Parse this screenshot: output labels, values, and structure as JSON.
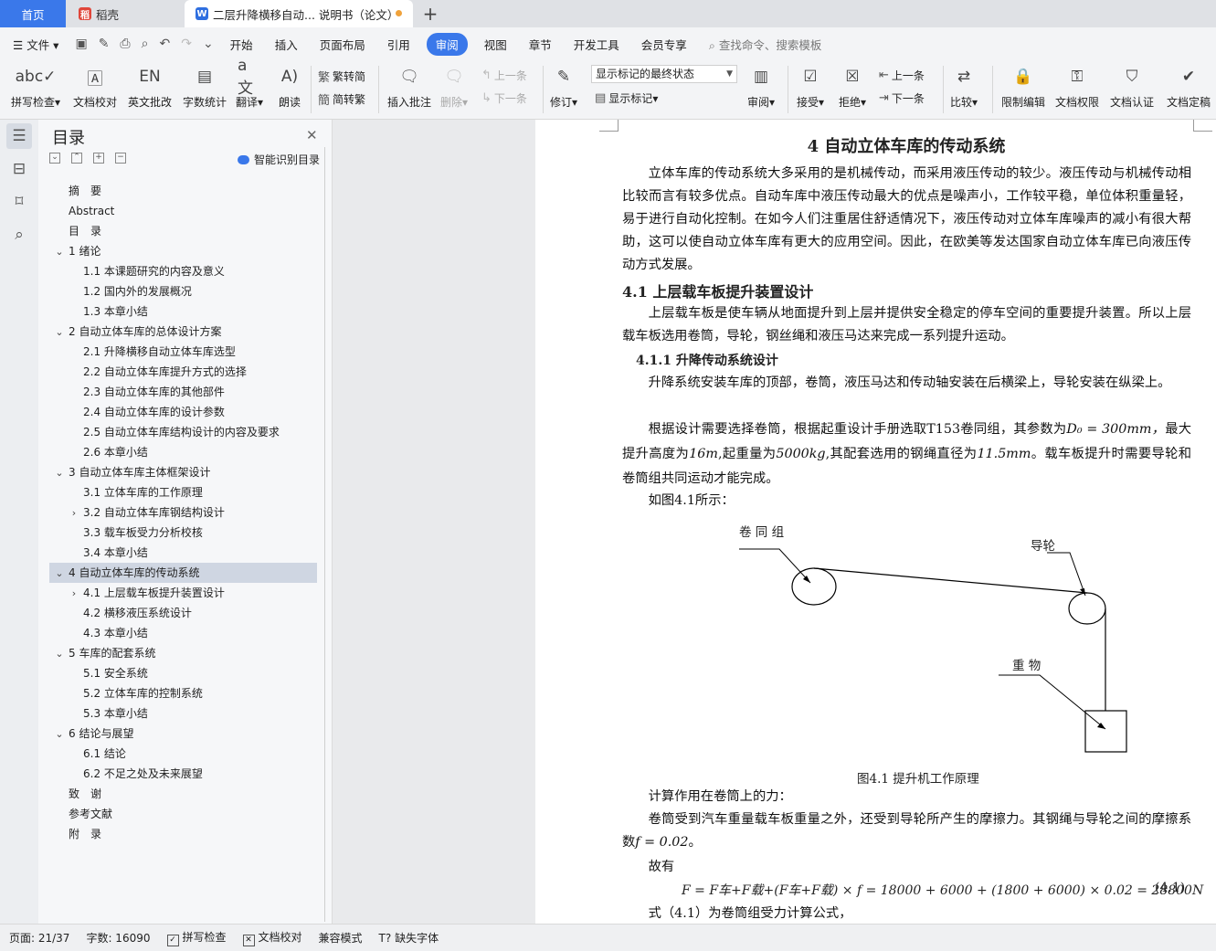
{
  "tabs": {
    "home": "首页",
    "daoke": "稻壳",
    "document": "二层升降横移自动... 说明书（论文）",
    "add": "+"
  },
  "menu": {
    "file": "文件",
    "items": [
      "开始",
      "插入",
      "页面布局",
      "引用",
      "审阅",
      "视图",
      "章节",
      "开发工具",
      "会员专享"
    ],
    "active": "审阅",
    "search": "查找命令、搜索模板"
  },
  "ribbon": {
    "spell_check": "拼写检查",
    "doc_proof": "文档校对",
    "english_review": "英文批改",
    "word_count": "字数统计",
    "translate": "翻译",
    "read_aloud": "朗读",
    "to_traditional": "繁转简",
    "to_simplified": "简转繁",
    "insert_comment": "插入批注",
    "delete": "删除",
    "prev": "上一条",
    "next": "下一条",
    "track_changes": "修订",
    "markup_mode": "显示标记的最终状态",
    "show_markup": "显示标记",
    "review": "审阅",
    "accept": "接受",
    "reject": "拒绝",
    "prev2": "上一条",
    "next2": "下一条",
    "compare": "比较",
    "restrict_edit": "限制编辑",
    "doc_permission": "文档权限",
    "doc_cert": "文档认证",
    "doc_final": "文档定稿"
  },
  "toc": {
    "title": "目录",
    "smart": "智能识别目录",
    "items": [
      {
        "label": "摘　要"
      },
      {
        "label": "Abstract"
      },
      {
        "label": "目　录"
      },
      {
        "label": "1  绪论"
      },
      {
        "label": "1.1  本课题研究的内容及意义"
      },
      {
        "label": "1.2 国内外的发展概况"
      },
      {
        "label": "1.3 本章小结"
      },
      {
        "label": "2  自动立体车库的总体设计方案"
      },
      {
        "label": "2.1  升降横移自动立体车库选型"
      },
      {
        "label": "2.2  自动立体车库提升方式的选择"
      },
      {
        "label": "2.3  自动立体车库的其他部件"
      },
      {
        "label": "2.4  自动立体车库的设计参数"
      },
      {
        "label": "2.5  自动立体车库结构设计的内容及要求"
      },
      {
        "label": "2.6  本章小结"
      },
      {
        "label": "3  自动立体车库主体框架设计"
      },
      {
        "label": "3.1 立体车库的工作原理"
      },
      {
        "label": "3.2 自动立体车库钢结构设计"
      },
      {
        "label": "3.3  载车板受力分析校核"
      },
      {
        "label": "3.4 本章小结"
      },
      {
        "label": "4  自动立体车库的传动系统"
      },
      {
        "label": "4.1   上层载车板提升装置设计"
      },
      {
        "label": "4.2  横移液压系统设计"
      },
      {
        "label": "4.3 本章小结"
      },
      {
        "label": "5  车库的配套系统"
      },
      {
        "label": "5.1  安全系统"
      },
      {
        "label": "5.2  立体车库的控制系统"
      },
      {
        "label": "5.3  本章小结"
      },
      {
        "label": "6  结论与展望"
      },
      {
        "label": "6.1 结论"
      },
      {
        "label": "6.2 不足之处及未来展望"
      },
      {
        "label": "致　谢"
      },
      {
        "label": "参考文献"
      },
      {
        "label": "附　录"
      }
    ]
  },
  "document": {
    "heading": "4  自动立体车库的传动系统",
    "p1": "立体车库的传动系统大多采用的是机械传动，而采用液压传动的较少。液压传动与机械传动相比较而言有较多优点。自动车库中液压传动最大的优点是噪声小，工作较平稳，单位体积重量轻，易于进行自动化控制。在如今人们注重居住舒适情况下，液压传动对立体车库噪声的减小有很大帮助，这可以使自动立体车库有更大的应用空间。因此，在欧美等发达国家自动立体车库已向液压传动方式发展。",
    "h2": "4.1  上层载车板提升装置设计",
    "p2": "上层载车板是使车辆从地面提升到上层并提供安全稳定的停车空间的重要提升装置。所以上层载车板选用卷筒，导轮，钢丝绳和液压马达来完成一系列提升运动。",
    "h3": "4.1.1  升降传动系统设计",
    "p3": "升降系统安装车库的顶部，卷筒，液压马达和传动轴安装在后横梁上，导轮安装在纵梁上。",
    "p4a": "根据设计需要选择卷筒，根据起重设计手册选取T153卷同组，其参数为",
    "p4_d0": "D₀ = 300mm，",
    "p4b": "最大提升高度为",
    "p4_h": "16m",
    "p4c": ",起重量为",
    "p4_w": "5000kg",
    "p4d": ",其配套选用的钢绳直径为",
    "p4_d": "11.5mm",
    "p4e": "。载车板提升时需要导轮和卷筒组共同运动才能完成。",
    "p5": "如图4.1所示：",
    "fig_labels": {
      "drum": "卷 同 组",
      "pulley": "导轮",
      "weight": "重 物"
    },
    "fig_caption": "图4.1  提升机工作原理",
    "p6": "计算作用在卷筒上的力：",
    "p7a": "卷筒受到汽车重量载车板重量之外，还受到导轮所产生的摩擦力。其钢绳与导轮之间的摩擦系数",
    "p7_f": "f = 0.02",
    "p7b": "。",
    "p8": "故有",
    "equation": "F = F车+F载+(F车+F载) × f = 18000 + 6000 + (1800 + 6000) × 0.02 = 28800N",
    "equation_num": "(4.1)",
    "p9": "式（4.1）为卷筒组受力计算公式，"
  },
  "status": {
    "page": "页面: 21/37",
    "words": "字数: 16090",
    "spell": "拼写检查",
    "proof": "文档校对",
    "compat": "兼容模式",
    "missing_font": "缺失字体"
  },
  "colors": {
    "accent": "#3a78ea",
    "toc_highlight": "#cfd6e2"
  }
}
